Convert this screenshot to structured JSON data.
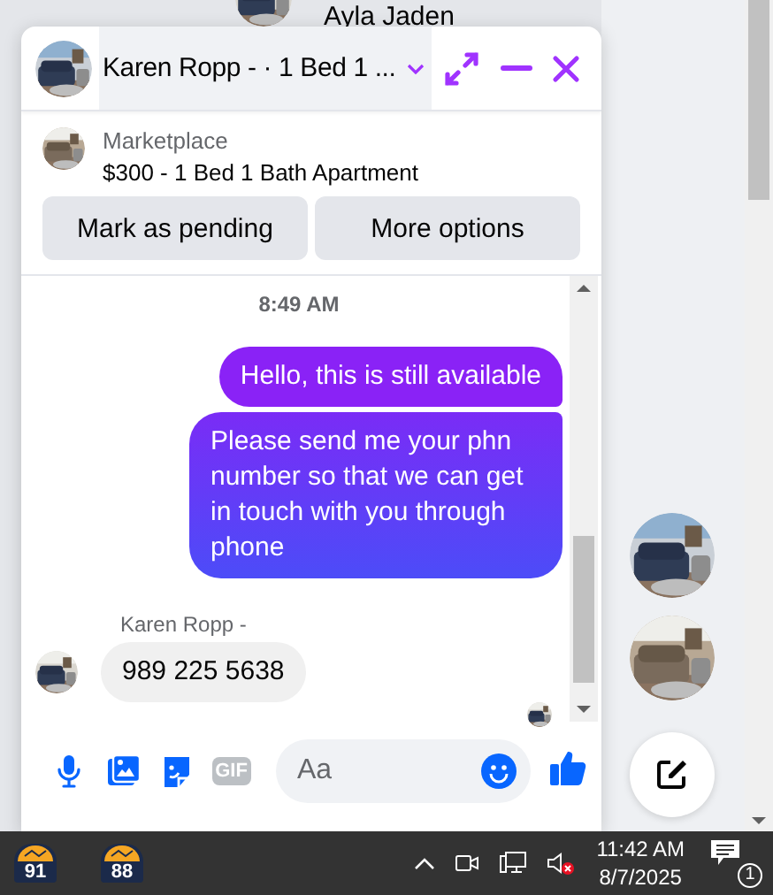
{
  "background_contact": {
    "name": "Ayla Jaden"
  },
  "chat": {
    "title": "Karen Ropp - · 1 Bed 1 ...",
    "listing": {
      "source": "Marketplace",
      "title": "$300 - 1 Bed 1 Bath Apartment"
    },
    "actions": [
      "Mark as pending",
      "More options"
    ],
    "timestamp": "8:49 AM",
    "messages": [
      {
        "kind": "outgoing",
        "text": "Hello, this is still available"
      },
      {
        "kind": "outgoing",
        "text": "Please send me your phn number so that we can get in touch with you through phone"
      },
      {
        "kind": "incoming",
        "sender": "Karen Ropp -",
        "text": "989 225 5638"
      }
    ],
    "composer": {
      "gif_label": "GIF",
      "placeholder": "Aa"
    }
  },
  "taskbar": {
    "apps": [
      {
        "label": "91"
      },
      {
        "label": "88"
      }
    ],
    "time": "11:42 AM",
    "date": "8/7/2025",
    "notifications": "1"
  }
}
